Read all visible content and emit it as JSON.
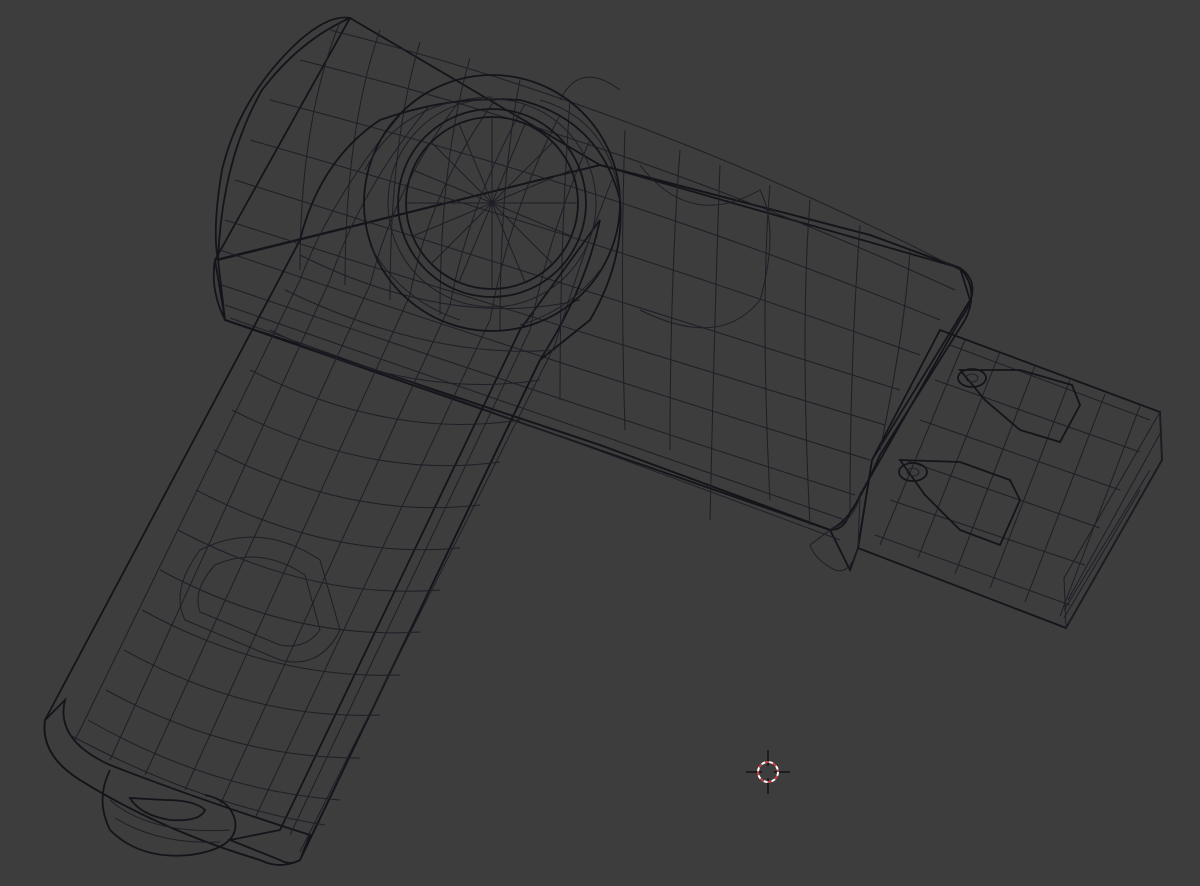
{
  "viewport": {
    "background": "#3d3d3d",
    "model": {
      "surface_color": "#d4d4e6",
      "highlight_color": "#e4e4f2",
      "shadow_color": "#a8a8bc",
      "wire_color": "#1e1e26",
      "cap_tint": "#cfc6de"
    },
    "cursor": {
      "icon": "3d-cursor-icon",
      "ring_color": "#c84040"
    }
  }
}
